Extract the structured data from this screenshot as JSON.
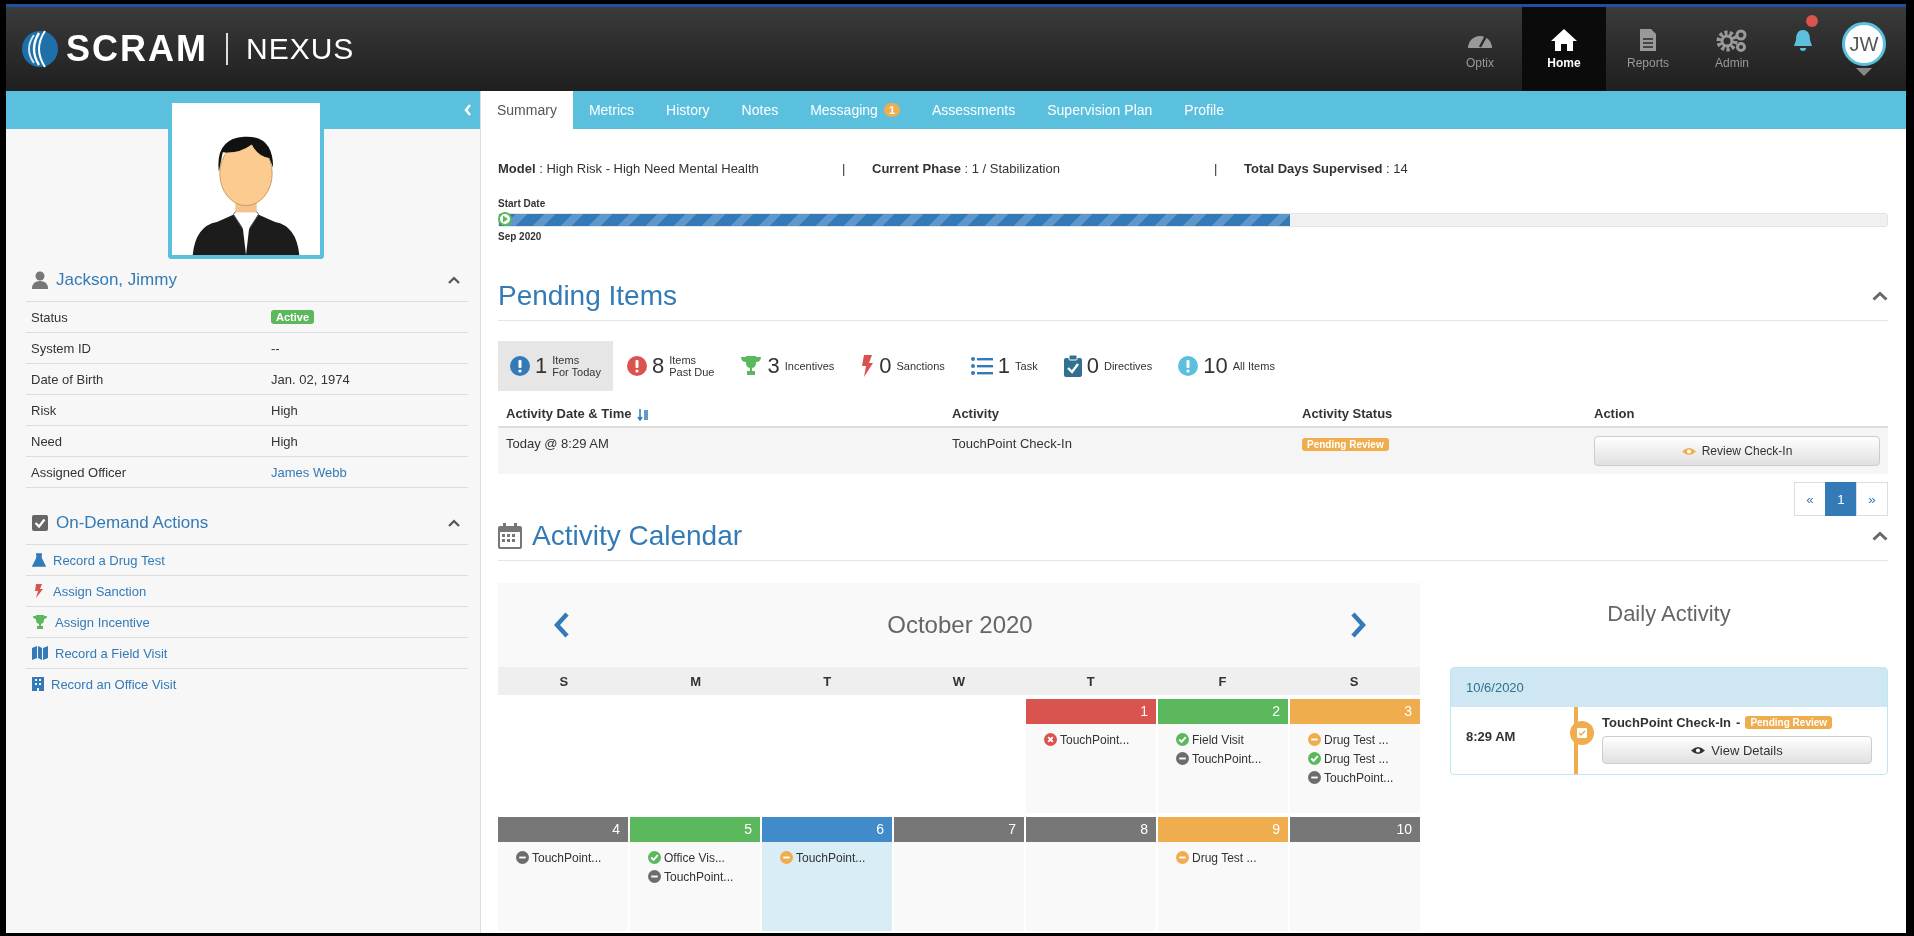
{
  "header": {
    "brand": "SCRAM",
    "product": "NEXUS",
    "nav": [
      {
        "label": "Optix",
        "kind": "gauge",
        "selected": false
      },
      {
        "label": "Home",
        "kind": "home",
        "selected": true
      },
      {
        "label": "Reports",
        "kind": "document",
        "selected": false
      },
      {
        "label": "Admin",
        "kind": "gears",
        "selected": false
      }
    ],
    "notifications": {
      "alert": true
    },
    "avatar": "JW"
  },
  "sidebar": {
    "name": "Jackson, Jimmy",
    "details": [
      {
        "label": "Status",
        "value": "Active",
        "kind": "badge"
      },
      {
        "label": "System ID",
        "value": "--",
        "kind": "text"
      },
      {
        "label": "Date of Birth",
        "value": "Jan. 02, 1974",
        "kind": "text"
      },
      {
        "label": "Risk",
        "value": "High",
        "kind": "text"
      },
      {
        "label": "Need",
        "value": "High",
        "kind": "text"
      },
      {
        "label": "Assigned Officer",
        "value": "James Webb",
        "kind": "link"
      }
    ],
    "actions_title": "On-Demand Actions",
    "actions": [
      {
        "label": "Record a Drug Test",
        "kind": "flask"
      },
      {
        "label": "Assign Sanction",
        "kind": "bolt"
      },
      {
        "label": "Assign Incentive",
        "kind": "trophy"
      },
      {
        "label": "Record a Field Visit",
        "kind": "map"
      },
      {
        "label": "Record an Office Visit",
        "kind": "building"
      }
    ]
  },
  "tabs": [
    {
      "label": "Summary",
      "selected": true
    },
    {
      "label": "Metrics",
      "selected": false
    },
    {
      "label": "History",
      "selected": false
    },
    {
      "label": "Notes",
      "selected": false
    },
    {
      "label": "Messaging",
      "selected": false,
      "badge": "1"
    },
    {
      "label": "Assessments",
      "selected": false
    },
    {
      "label": "Supervision Plan",
      "selected": false
    },
    {
      "label": "Profile",
      "selected": false
    }
  ],
  "summary": {
    "fields": [
      {
        "label": "Model",
        "value": ": High Risk - High Need Mental Health"
      },
      {
        "separator": "|",
        "label": "Current Phase",
        "value": ": 1 / Stabilization"
      },
      {
        "separator": "|",
        "label": "Total Days Supervised",
        "value": ": 14"
      }
    ],
    "progress": {
      "start_label": "Start Date",
      "date": "Sep 2020",
      "level": 0.57
    }
  },
  "pending": {
    "title": "Pending Items",
    "filters": [
      {
        "count": "1",
        "lines": [
          "Items",
          "For Today"
        ],
        "kind": "today",
        "selected": true
      },
      {
        "count": "8",
        "lines": [
          "Items",
          "Past Due"
        ],
        "kind": "pastdue",
        "selected": false
      },
      {
        "count": "3",
        "lines": [
          "Incentives"
        ],
        "kind": "trophy",
        "selected": false
      },
      {
        "count": "0",
        "lines": [
          "Sanctions"
        ],
        "kind": "bolt",
        "selected": false
      },
      {
        "count": "1",
        "lines": [
          "Task"
        ],
        "kind": "list",
        "selected": false
      },
      {
        "count": "0",
        "lines": [
          "Directives"
        ],
        "kind": "clipboard",
        "selected": false
      },
      {
        "count": "10",
        "lines": [
          "All Items"
        ],
        "kind": "all",
        "selected": false
      }
    ],
    "columns": [
      "Activity Date & Time",
      "Activity",
      "Activity Status",
      "Action"
    ],
    "rows": [
      {
        "date": "Today @ 8:29 AM",
        "activity": "TouchPoint Check-In",
        "status": "Pending Review",
        "action": "Review Check-In"
      }
    ],
    "pagination": [
      {
        "label": "«",
        "selected": false
      },
      {
        "label": "1",
        "selected": true
      },
      {
        "label": "»",
        "selected": false
      }
    ]
  },
  "calendar": {
    "title": "Activity Calendar",
    "month": "October 2020",
    "weekdays": [
      "S",
      "M",
      "T",
      "W",
      "T",
      "F",
      "S"
    ],
    "weeks": [
      {
        "days": [
          {
            "kind": "empty"
          },
          {
            "kind": "empty"
          },
          {
            "kind": "empty"
          },
          {
            "kind": "empty"
          },
          {
            "kind": "day",
            "day": "1",
            "color": "#d9534f",
            "selected": false,
            "events": [
              {
                "text": "TouchPoint...",
                "kind": "failed"
              }
            ]
          },
          {
            "kind": "day",
            "day": "2",
            "color": "#5cb85c",
            "selected": false,
            "events": [
              {
                "text": "Field Visit",
                "kind": "passed"
              },
              {
                "text": "TouchPoint...",
                "kind": "neutral"
              }
            ]
          },
          {
            "kind": "day",
            "day": "3",
            "color": "#f0ad4e",
            "selected": false,
            "events": [
              {
                "text": "Drug Test ...",
                "kind": "pending"
              },
              {
                "text": "Drug Test ...",
                "kind": "passed"
              },
              {
                "text": "TouchPoint...",
                "kind": "neutral"
              }
            ]
          }
        ]
      },
      {
        "days": [
          {
            "kind": "day",
            "day": "4",
            "color": "#777777",
            "selected": false,
            "events": [
              {
                "text": "TouchPoint...",
                "kind": "neutral"
              }
            ]
          },
          {
            "kind": "day",
            "day": "5",
            "color": "#5cb85c",
            "selected": false,
            "events": [
              {
                "text": "Office Vis...",
                "kind": "passed"
              },
              {
                "text": "TouchPoint...",
                "kind": "neutral"
              }
            ]
          },
          {
            "kind": "day",
            "day": "6",
            "color": "#428bca",
            "selected": true,
            "events": [
              {
                "text": "TouchPoint...",
                "kind": "pending"
              }
            ]
          },
          {
            "kind": "day",
            "day": "7",
            "color": "#777777",
            "selected": false
          },
          {
            "kind": "day",
            "day": "8",
            "color": "#777777",
            "selected": false
          },
          {
            "kind": "day",
            "day": "9",
            "color": "#f0ad4e",
            "selected": false,
            "events": [
              {
                "text": "Drug Test ...",
                "kind": "pending"
              }
            ]
          },
          {
            "kind": "day",
            "day": "10",
            "color": "#777777",
            "selected": false
          }
        ]
      }
    ]
  },
  "daily": {
    "title": "Daily Activity",
    "date": "10/6/2020",
    "entries": [
      {
        "time": "8:29 AM",
        "title": "TouchPoint Check-In",
        "dash": "-",
        "status": "Pending Review",
        "button": "View Details"
      }
    ]
  }
}
